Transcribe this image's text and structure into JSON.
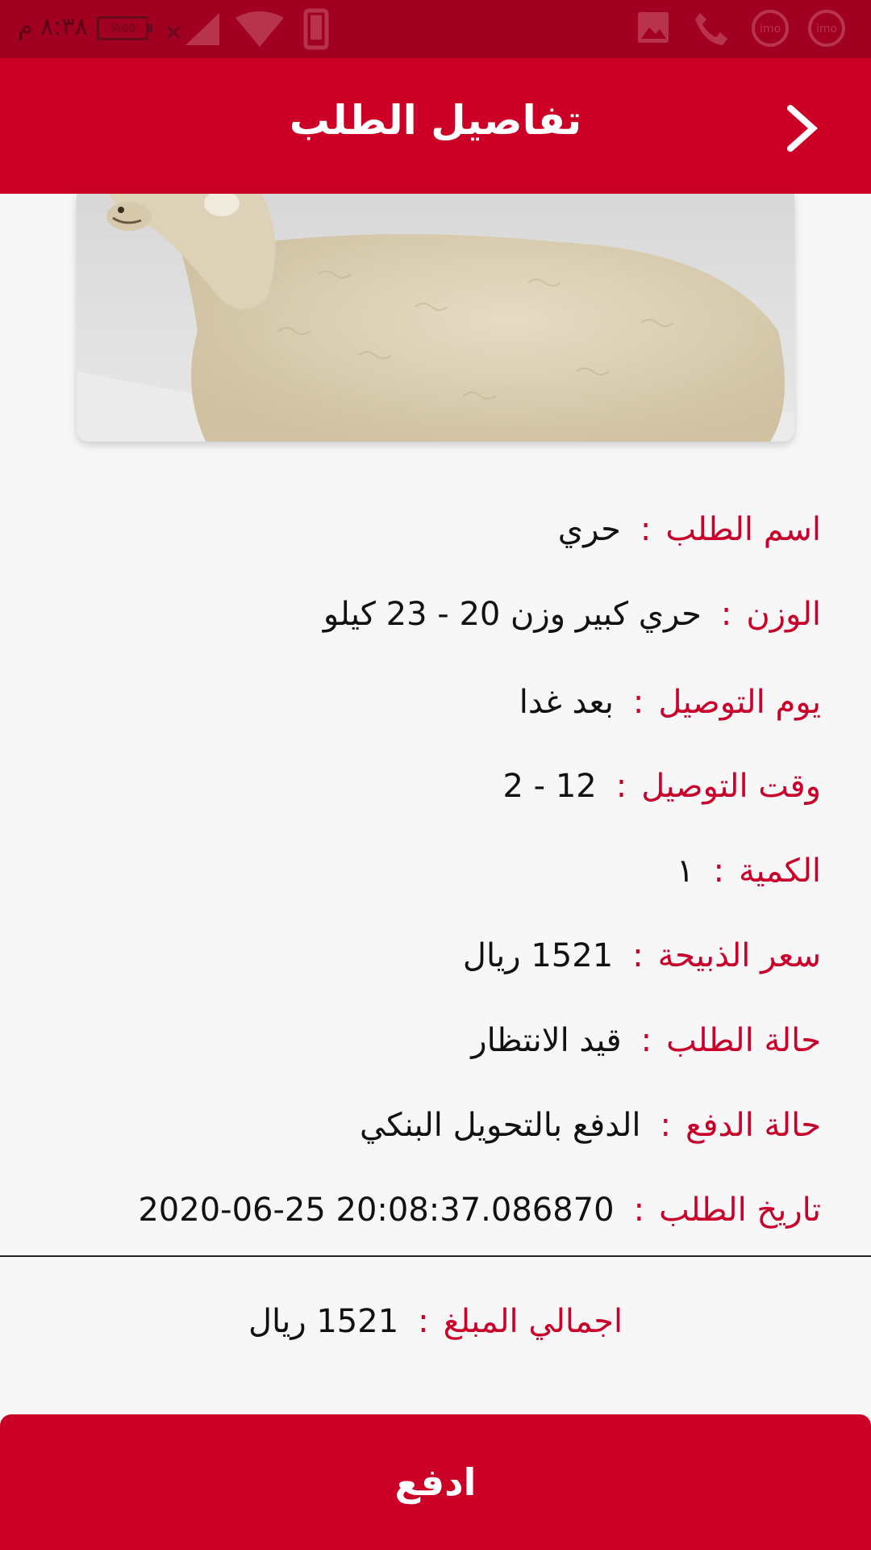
{
  "status_bar": {
    "time": "٨:٣٨ م",
    "battery": "%٥٥",
    "icons": [
      "imo-icon",
      "imo-icon",
      "phone-icon",
      "image-icon",
      "device-icon",
      "wifi-icon",
      "signal-icon"
    ]
  },
  "header": {
    "title": "تفاصيل الطلب",
    "back_icon": "chevron-right-icon"
  },
  "details": [
    {
      "label": "اسم الطلب",
      "value": "حري"
    },
    {
      "label": "الوزن",
      "value": "حري كبير وزن 20 - 23 كيلو"
    },
    {
      "label": "يوم التوصيل",
      "value": "بعد غدا"
    },
    {
      "label": "وقت التوصيل",
      "value": "12 - 2"
    },
    {
      "label": "الكمية",
      "value": "١"
    },
    {
      "label": "سعر الذبيحة",
      "value": "1521 ريال"
    },
    {
      "label": "حالة الطلب",
      "value": "قيد الانتظار"
    },
    {
      "label": "حالة الدفع",
      "value": "الدفع بالتحويل البنكي"
    },
    {
      "label": "تاريخ الطلب",
      "value": "2020-06-25 20:08:37.086870"
    }
  ],
  "total": {
    "label": "اجمالي المبلغ",
    "value": "1521 ريال"
  },
  "colon": ":",
  "pay_button": "ادفع",
  "colors": {
    "primary": "#cc0026",
    "status_bar": "#a10021",
    "label": "#c8002a"
  }
}
